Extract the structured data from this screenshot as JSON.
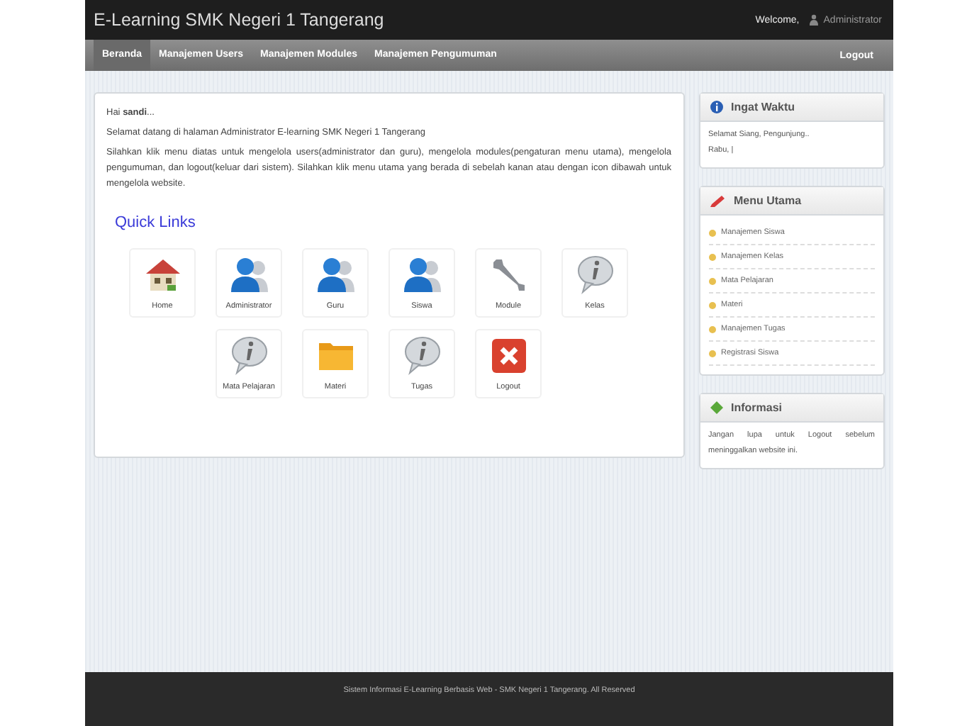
{
  "header": {
    "title": "E-Learning SMK Negeri 1 Tangerang",
    "welcome": "Welcome,",
    "user": "Administrator"
  },
  "nav": {
    "items": [
      {
        "label": "Beranda",
        "selected": true
      },
      {
        "label": "Manajemen Users",
        "selected": false
      },
      {
        "label": "Manajemen Modules",
        "selected": false
      },
      {
        "label": "Manajemen Pengumuman",
        "selected": false
      }
    ],
    "logout": "Logout"
  },
  "main": {
    "greeting": "Hai **sandi**...",
    "welcome": "Selamat datang di halaman Administrator E-learning SMK Negeri 1 Tangerang",
    "instructions": "Silahkan klik menu diatas untuk mengelola users(administrator dan guru), mengelola modules(pengaturan menu utama), mengelola pengumuman, dan logout(keluar dari sistem). Silahkan klik menu utama yang berada di sebelah kanan atau dengan icon dibawah untuk mengelola website.",
    "quick_links_title": "Quick Links",
    "quick_links": [
      [
        {
          "label": "Home",
          "kind": "house"
        },
        {
          "label": "Administrator",
          "kind": "user"
        },
        {
          "label": "Guru",
          "kind": "user"
        },
        {
          "label": "Siswa",
          "kind": "user"
        },
        {
          "label": "Module",
          "kind": "wrench"
        },
        {
          "label": "Kelas",
          "kind": "info"
        }
      ],
      [
        {
          "label": "Mata Pelajaran",
          "kind": "info"
        },
        {
          "label": "Materi",
          "kind": "folder"
        },
        {
          "label": "Tugas",
          "kind": "info"
        },
        {
          "label": "Logout",
          "kind": "close"
        }
      ]
    ]
  },
  "sidebar": [
    {
      "title": "Ingat Waktu",
      "kind": "info",
      "lines": [
        "Selamat Siang, Pengunjung..",
        "Rabu, |"
      ]
    },
    {
      "title": "Menu Utama",
      "kind": "menu",
      "items": [
        "Manajemen Siswa",
        "Manajemen Kelas",
        "Mata Pelajaran",
        "Materi",
        "Manajemen Tugas",
        "Registrasi Siswa"
      ]
    },
    {
      "title": "Informasi",
      "kind": "text",
      "text": "Jangan lupa untuk Logout sebelum meninggalkan website ini."
    }
  ],
  "footer": {
    "text": "Sistem Informasi E-Learning Berbasis Web - SMK Negeri 1 Tangerang. All Reserved"
  }
}
